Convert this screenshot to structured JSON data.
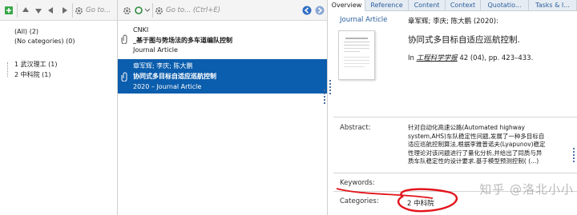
{
  "left_toolbar": {
    "search_placeholder": "Go to..."
  },
  "middle_toolbar": {
    "search_placeholder": "Go to... (Ctrl+E)"
  },
  "categories": {
    "all": "(All) (2)",
    "none": "(No categories) (0)",
    "items": [
      {
        "label": "1 武汉理工 (1)"
      },
      {
        "label": "2 中科院 (1)"
      }
    ]
  },
  "references": [
    {
      "line1": "CNKI",
      "line2": "_基于图与势场法的多车道编队控制",
      "line3": "Journal Article",
      "selected": false
    },
    {
      "line1": "章军辉; 李庆; 陈大鹏",
      "line2": "协同式多目标自适应巡航控制",
      "line3": "2020 – Journal Article",
      "selected": true
    }
  ],
  "tabs": [
    {
      "label": "Overview",
      "active": true
    },
    {
      "label": "Reference",
      "active": false
    },
    {
      "label": "Content",
      "active": false
    },
    {
      "label": "Context",
      "active": false
    },
    {
      "label": "Quotatio...",
      "active": false
    },
    {
      "label": "Tasks & I...",
      "active": false
    }
  ],
  "overview": {
    "type": "Journal Article",
    "authors": "章军辉; 李庆; 陈大鹏 (2020):",
    "title": "协同式多目标自适应巡航控制.",
    "source_prefix": "In",
    "journal": "工程科学学报",
    "source_suffix": "42 (04), pp. 423–433."
  },
  "abstract": {
    "label": "Abstract:",
    "lines": [
      "针对自动化高速公路(Automated highway",
      "system,AHS)车队稳定性问题,发展了一种多目标自",
      "适应巡航控制算法,根据李雅普诺夫(Lyapunov)稳定",
      "性理论对该问题进行了量化分析,并给出了同质与异",
      "质车队稳定性的设计要求.基于模型预测控制( (...)"
    ]
  },
  "keywords": {
    "label": "Keywords:"
  },
  "categories_field": {
    "label": "Categories:",
    "value": "2 中科院"
  },
  "watermark": "知乎 @洛北小小",
  "colors": {
    "selection": "#0b5dad",
    "annotation": "#e2141b",
    "link": "#2b5e9c"
  },
  "icons": [
    "add-icon",
    "arrow-up-icon",
    "arrow-down-icon",
    "arrow-left-icon",
    "arrow-right-icon",
    "gear-icon",
    "search-icon",
    "attachment-icon",
    "back-icon",
    "forward-icon"
  ]
}
